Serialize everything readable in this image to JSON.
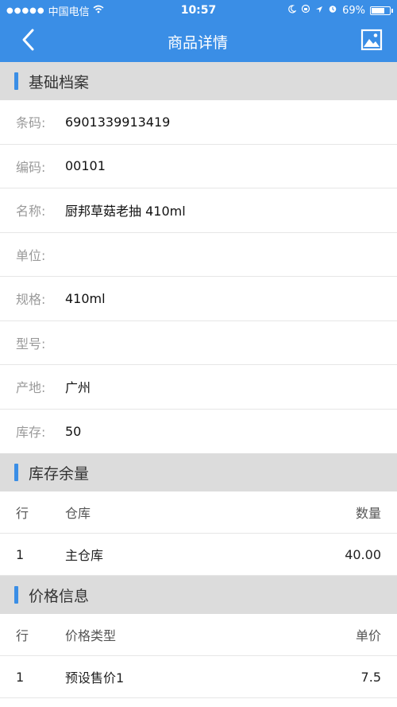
{
  "status_bar": {
    "carrier": "中国电信",
    "time": "10:57",
    "battery": "69%"
  },
  "nav": {
    "title": "商品详情",
    "back_icon": "chevron-left-icon",
    "image_icon": "image-icon"
  },
  "basic": {
    "title": "基础档案",
    "rows": [
      {
        "label": "条码:",
        "value": "6901339913419"
      },
      {
        "label": "编码:",
        "value": "00101"
      },
      {
        "label": "名称:",
        "value": "厨邦草菇老抽 410ml"
      },
      {
        "label": "单位:",
        "value": ""
      },
      {
        "label": "规格:",
        "value": "410ml"
      },
      {
        "label": "型号:",
        "value": ""
      },
      {
        "label": "产地:",
        "value": "广州"
      },
      {
        "label": "库存:",
        "value": "50"
      }
    ]
  },
  "stock": {
    "title": "库存余量",
    "headers": [
      "行",
      "仓库",
      "数量"
    ],
    "rows": [
      [
        "1",
        "主仓库",
        "40.00"
      ]
    ]
  },
  "price": {
    "title": "价格信息",
    "headers": [
      "行",
      "价格类型",
      "单价"
    ],
    "rows": [
      [
        "1",
        "预设售价1",
        "7.5"
      ]
    ]
  },
  "colors": {
    "accent": "#3a8ee6",
    "section_bg": "#dcdcdc"
  }
}
